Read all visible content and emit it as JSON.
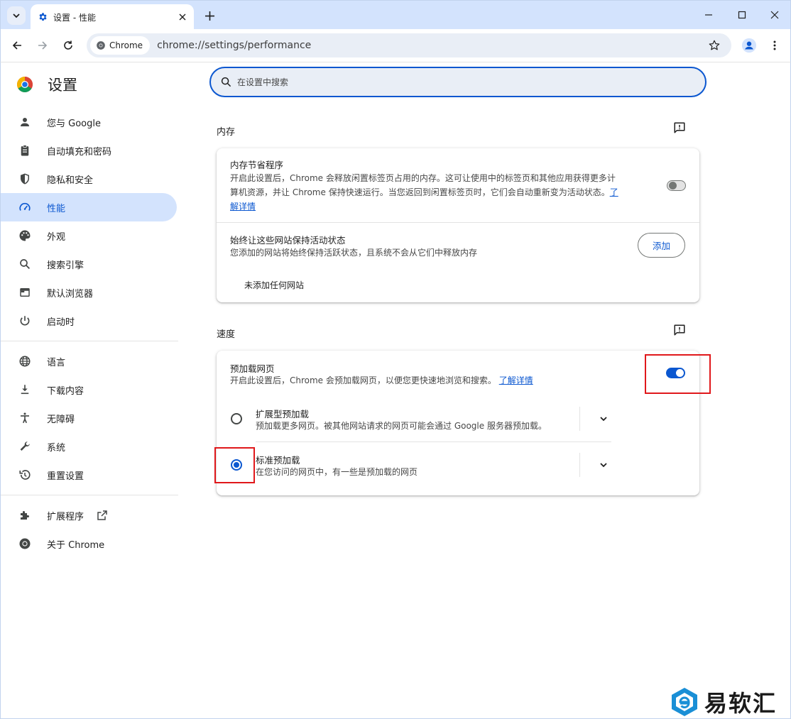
{
  "browser": {
    "tab_title": "设置 - 性能",
    "chip_label": "Chrome",
    "url": "chrome://settings/performance"
  },
  "settings": {
    "heading": "设置",
    "search_placeholder": "在设置中搜索"
  },
  "sidebar": {
    "items": [
      {
        "label": "您与 Google",
        "icon": "person-icon"
      },
      {
        "label": "自动填充和密码",
        "icon": "clipboard-icon"
      },
      {
        "label": "隐私和安全",
        "icon": "shield-icon"
      },
      {
        "label": "性能",
        "icon": "speedometer-icon",
        "active": true
      },
      {
        "label": "外观",
        "icon": "palette-icon"
      },
      {
        "label": "搜索引擎",
        "icon": "search-icon"
      },
      {
        "label": "默认浏览器",
        "icon": "browser-icon"
      },
      {
        "label": "启动时",
        "icon": "power-icon"
      }
    ],
    "items2": [
      {
        "label": "语言",
        "icon": "globe-icon"
      },
      {
        "label": "下载内容",
        "icon": "download-icon"
      },
      {
        "label": "无障碍",
        "icon": "accessibility-icon"
      },
      {
        "label": "系统",
        "icon": "wrench-icon"
      },
      {
        "label": "重置设置",
        "icon": "history-icon"
      }
    ],
    "items3": [
      {
        "label": "扩展程序",
        "icon": "puzzle-icon"
      },
      {
        "label": "关于 Chrome",
        "icon": "chrome-icon"
      }
    ]
  },
  "memory": {
    "section_title": "内存",
    "saver_title": "内存节省程序",
    "saver_desc_line1": "开启此设置后，Chrome 会释放闲置标签页占用的内存。这可让使用中的标签页和其他应用获得更多计",
    "saver_desc_line2": "算机资源，并让 Chrome 保持快速运行。当您返回到闲置标签页时，它们会自动重新变为活动状态。",
    "saver_link_1": "了",
    "saver_link_2": "解详情",
    "saver_enabled": false,
    "keep_title": "始终让这些网站保持活动状态",
    "keep_desc": "您添加的网站将始终保持活跃状态，且系统不会从它们中释放内存",
    "add_label": "添加",
    "empty_text": "未添加任何网站"
  },
  "speed": {
    "section_title": "速度",
    "preload_title": "预加载网页",
    "preload_desc": "开启此设置后，Chrome 会预加载网页，以便您更快速地浏览和搜索。",
    "preload_link": "了解详情",
    "preload_enabled": true,
    "options": [
      {
        "title": "扩展型预加载",
        "desc": "预加载更多网页。被其他网站请求的网页可能会通过 Google 服务器预加载。",
        "checked": false
      },
      {
        "title": "标准预加载",
        "desc": "在您访问的网页中，有一些是预加载的网页",
        "checked": true
      }
    ]
  },
  "watermark": {
    "text": "易软汇"
  },
  "colors": {
    "accent": "#0b57d0",
    "highlight": "#e0181b",
    "active_nav_bg": "#d3e3fd"
  }
}
